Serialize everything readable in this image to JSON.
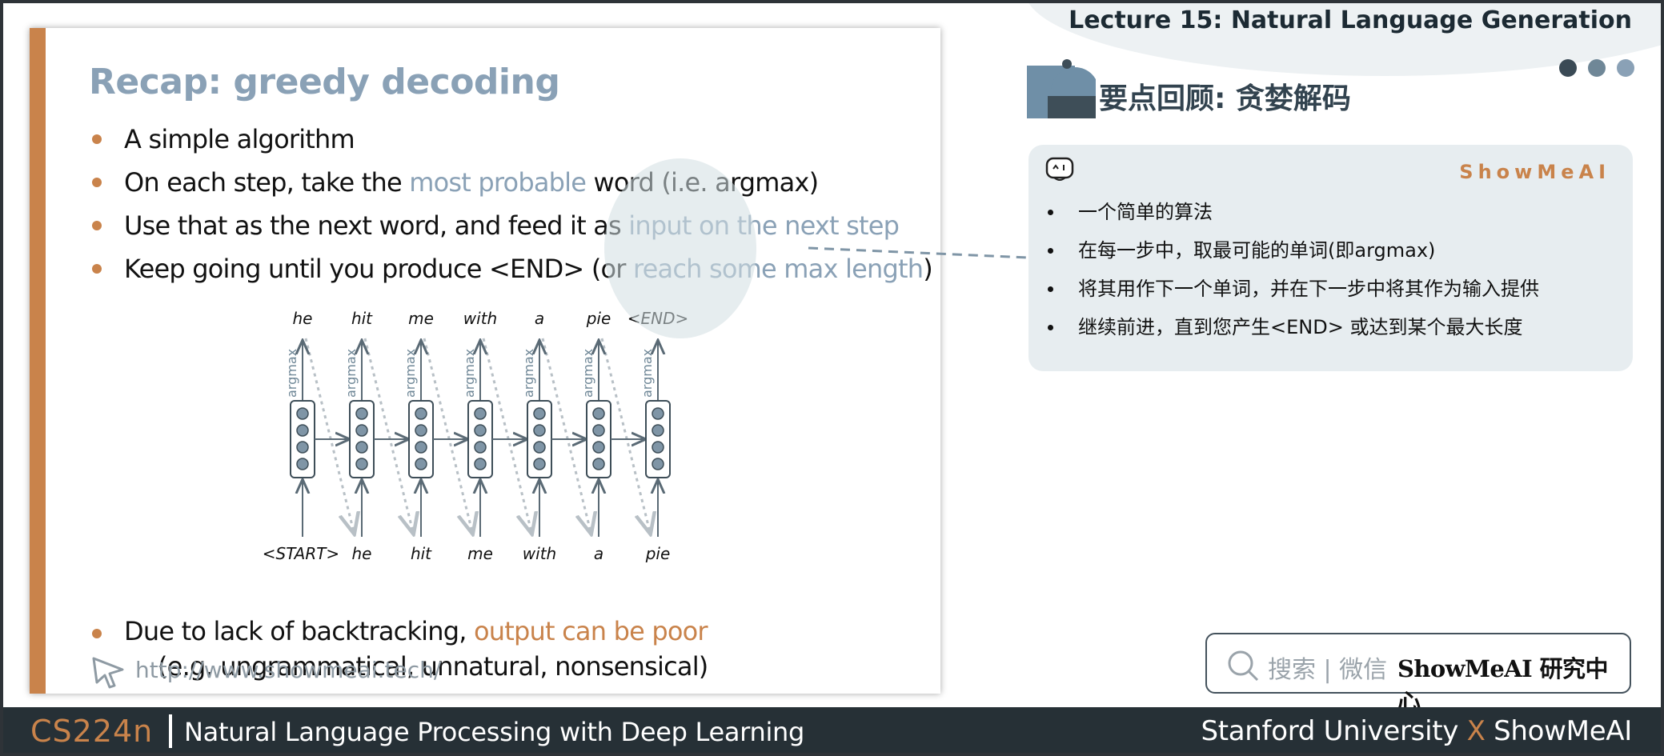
{
  "header": {
    "lecture_title": "Lecture 15: Natural Language Generation",
    "dots_colors": [
      "#3a4a55",
      "#6f8797",
      "#8aa1b6"
    ]
  },
  "slide": {
    "title": "Recap: greedy decoding",
    "bullets": [
      {
        "parts": [
          "A simple algorithm"
        ]
      },
      {
        "pre": "On each step, take the ",
        "hl": "most probable",
        "post": " word (i.e. argmax)"
      },
      {
        "pre": "Use that as the next word, and feed it as ",
        "hl": "input on the next step",
        "post": ""
      },
      {
        "pre": "Keep going until you produce <END> (or ",
        "hl": "reach some max length",
        "post": ")"
      }
    ],
    "diagram": {
      "outputs": [
        "he",
        "hit",
        "me",
        "with",
        "a",
        "pie",
        "<END>"
      ],
      "inputs": [
        "<START>",
        "he",
        "hit",
        "me",
        "with",
        "a",
        "pie"
      ],
      "arrow_label": "argmax"
    },
    "bottom_bullet": {
      "pre": "Due to lack of backtracking, ",
      "hl": "output can be poor",
      "line2": "(e.g. ungrammatical, unnatural, nonsensical)"
    },
    "url": "http://www.showmeai.tech/"
  },
  "notes": {
    "section_title": "要点回顾: 贪婪解码",
    "brand": "ShowMeAI",
    "items": [
      "一个简单的算法",
      "在每一步中，取最可能的单词(即argmax)",
      "将其用作下一个单词，并在下一步中将其作为输入提供",
      "继续前进，直到您产生<END> 或达到某个最大长度"
    ]
  },
  "search": {
    "placeholder": "搜索 | 微信",
    "brand_text": "ShowMeAI 研究中心"
  },
  "footer": {
    "course": "CS224n",
    "subtitle": "Natural Language Processing with Deep Learning",
    "right_pre": "Stanford University ",
    "right_x": "X",
    "right_post": " ShowMeAI"
  },
  "colors": {
    "accent_orange": "#c9834b",
    "accent_blue": "#8aa1b6",
    "footer_bg": "#263036"
  }
}
